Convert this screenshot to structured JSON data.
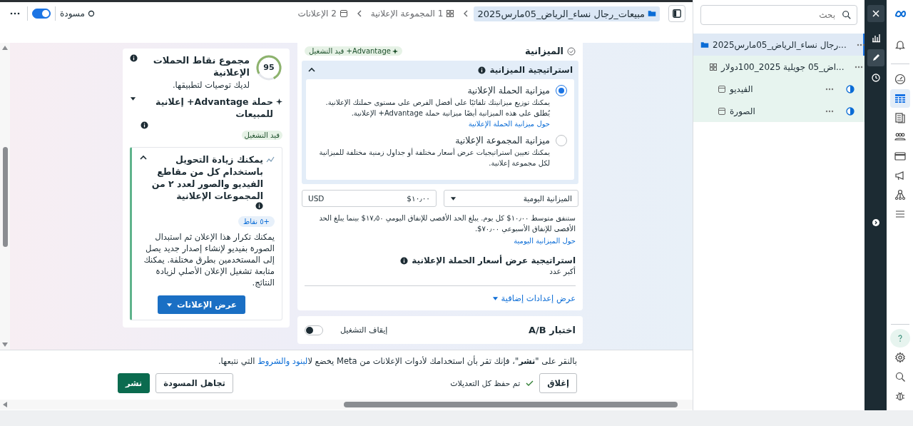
{
  "top_bar": {
    "breadcrumbs": [
      {
        "label": "مبيعات_رجال نساء_الرياض_05مارس2025",
        "kind": "campaign",
        "selected": true
      },
      {
        "label": "1 المجموعة الإعلانية",
        "kind": "adset",
        "selected": false
      },
      {
        "label": "2 الإعلانات",
        "kind": "ad",
        "selected": false
      }
    ],
    "status": "مسودة",
    "toggle": {
      "on": true
    }
  },
  "score_card": {
    "score": "95",
    "level": 0.95,
    "title": "مجموع نقاط الحملات الإعلانية",
    "subtitle": "لديك توصيات لتطبيقها.",
    "campaign": "حملة Advantage+ إعلانية للمبيعات",
    "campaign_status": "قيد التشغيل",
    "recommendation": {
      "expanded": true,
      "title": "يمكنك زيادة التحويل باستخدام كل من مقاطع الفيديو والصور لعدد ٢ من المجموعات الإعلانية",
      "points": "+٥ نقاط",
      "body": "يمكنك تكرار هذا الإعلان ثم استبدال الصورة بفيديو لإنشاء إصدار جديد يصل إلى المستخدمين بطرق مختلفة. يمكنك متابعة تشغيل الإعلان الأصلي لزيادة النتائج.",
      "button": "عرض الإعلانات"
    }
  },
  "budget": {
    "title": "الميزانية",
    "badge": "Advantage+ قيد التشغيل",
    "strategy": {
      "title": "استراتيجية الميزانية",
      "expanded": true,
      "options": [
        {
          "title": "ميزانية الحملة الإعلانية",
          "description": "يمكنك توزيع ميزانيتك تلقائيًا على أفضل الفرص على مستوى حملتك الإعلانية. يُطلق على هذه الميزانية أيضًا ميزانية حملة Advantage+ الإعلانية.",
          "link": "حول ميزانية الحملة الإعلانية",
          "selected": true
        },
        {
          "title": "ميزانية المجموعة الإعلانية",
          "description": "يمكنك تعيين استراتيجيات عرض أسعار مختلفة أو جداول زمنية مختلفة للميزانية لكل مجموعة إعلانية.",
          "selected": false
        }
      ]
    },
    "budget_type": "الميزانية اليومية",
    "amount": "١٠٫٠٠$",
    "currency": "USD",
    "note": "ستنفق متوسط ١٠٫٠٠$ كل يوم. يبلغ الحد الأقصى للإنفاق اليومي ١٧٫٥٠$ بينما يبلغ الحد الأقصى للإنفاق الأسبوعي ٧٠٫٠٠$.",
    "note_link": "حول الميزانية اليومية",
    "bid_strategy_label": "استراتيجية عرض أسعار الحملة الإعلانية",
    "bid_strategy_value": "أكبر عدد",
    "more_settings": "عرض إعدادات إضافية"
  },
  "ab_test": {
    "title": "اختبار A/B",
    "toggle_label": "إيقاف التشغيل",
    "on": false
  },
  "footer": {
    "notice_before": "بالنقر على \"**نشر**\"، فإنك تقر بأن استخدامك لأدوات الإعلانات من Meta يخضع ل",
    "notice_link": "البنود والشروط",
    "notice_after": " التي نتبعها.",
    "close": "إغلاق",
    "saved": "تم حفظ كل التعديلات",
    "discard": "تجاهل المسودة",
    "publish": "نشر"
  },
  "tree": {
    "search": {
      "placeholder": "بحث"
    },
    "items": [
      {
        "label": "...رجال نساء_الرياض_05مارس2025",
        "kind": "campaign",
        "selected": true,
        "children": [
          {
            "label": "...اض_05 جويلية 2025_100دولار",
            "kind": "adset",
            "selected": false,
            "children": [
              {
                "label": "الفيديو",
                "kind": "ad",
                "selected": false
              },
              {
                "label": "الصورة",
                "kind": "ad",
                "selected": false
              }
            ]
          }
        ]
      }
    ]
  },
  "tool_strip": {
    "items": [
      {
        "kind": "chart",
        "selected": false
      },
      {
        "kind": "edit",
        "selected": true
      },
      {
        "kind": "history",
        "selected": false
      }
    ]
  },
  "nav_rail": {
    "top": [
      {
        "kind": "logo",
        "selected": false
      },
      {
        "kind": "notifications",
        "selected": false
      },
      {
        "kind": "dashboard",
        "selected": false
      },
      {
        "kind": "table",
        "selected": true
      },
      {
        "kind": "pages",
        "selected": false
      },
      {
        "kind": "audience",
        "selected": false
      },
      {
        "kind": "billing",
        "selected": false
      },
      {
        "kind": "ads",
        "selected": false
      },
      {
        "kind": "network",
        "selected": false
      },
      {
        "kind": "menu",
        "selected": false
      }
    ],
    "bottom": [
      {
        "kind": "help",
        "selected": false
      },
      {
        "kind": "settings",
        "selected": false
      },
      {
        "kind": "search",
        "selected": false
      },
      {
        "kind": "bug",
        "selected": false
      }
    ]
  }
}
